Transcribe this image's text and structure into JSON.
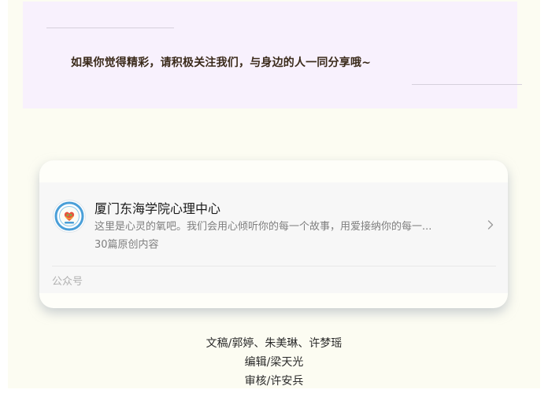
{
  "promo": {
    "message": "如果你觉得精彩，请积极关注我们，与身边的人一同分享哦~"
  },
  "account_card": {
    "name": "厦门东海学院心理中心",
    "description": "这里是心灵的氧吧。我们会用心倾听你的每一个故事，用爱接纳你的每一...",
    "count": "30篇原创内容",
    "type_label": "公众号",
    "icons": {
      "avatar": "school-logo-icon",
      "arrow": "chevron-right-icon"
    }
  },
  "credits": {
    "writers": "文稿/郭婷、朱美琳、许梦瑶",
    "editor": "编辑/梁天光",
    "reviewer": "审核/许安兵"
  },
  "colors": {
    "page_background": "#fcfcf2",
    "promo_background": "#f8f1fd",
    "card_inner": "#f7f7f7",
    "promo_text": "#3a2a1a"
  }
}
